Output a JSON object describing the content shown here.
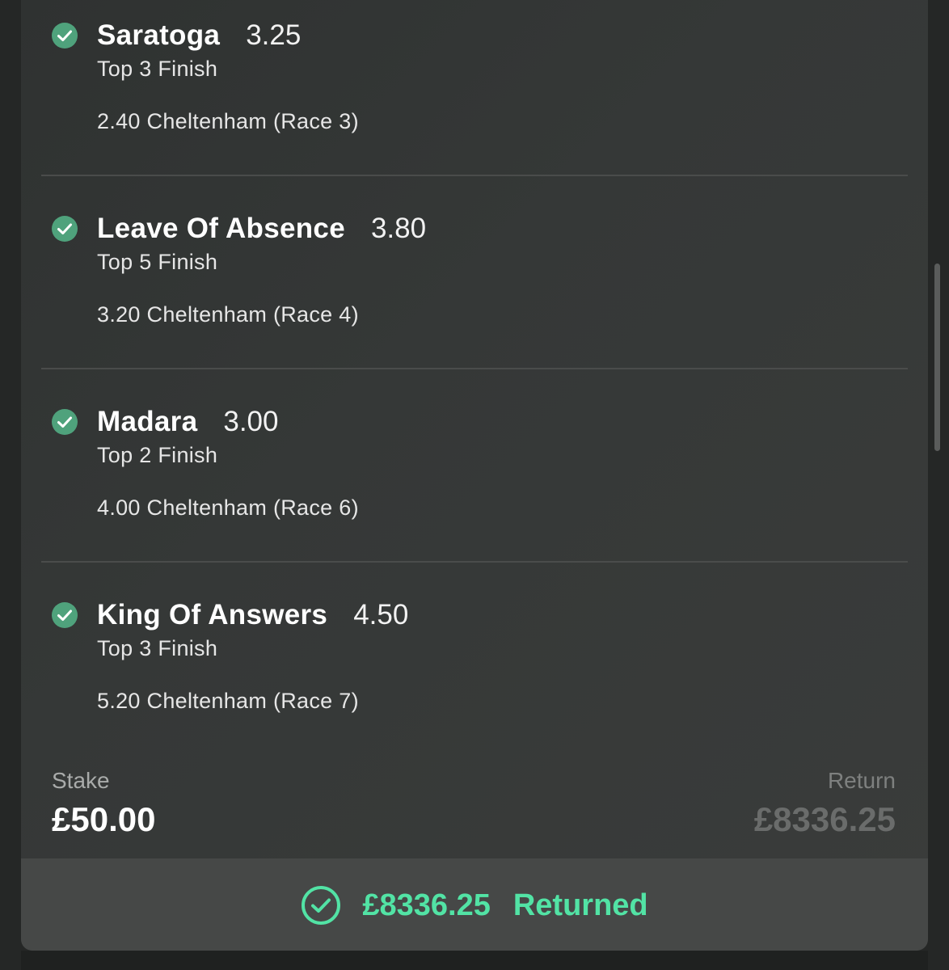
{
  "legs": [
    {
      "selection": "Saratoga",
      "odds": "3.25",
      "market": "Top 3 Finish",
      "event": "2.40 Cheltenham (Race 3)"
    },
    {
      "selection": "Leave Of Absence",
      "odds": "3.80",
      "market": "Top 5 Finish",
      "event": "3.20 Cheltenham (Race 4)"
    },
    {
      "selection": "Madara",
      "odds": "3.00",
      "market": "Top 2 Finish",
      "event": "4.00 Cheltenham (Race 6)"
    },
    {
      "selection": "King Of Answers",
      "odds": "4.50",
      "market": "Top 3 Finish",
      "event": "5.20 Cheltenham (Race 7)"
    }
  ],
  "summary": {
    "stake_label": "Stake",
    "stake_value": "£50.00",
    "return_label": "Return",
    "return_value": "£8336.25"
  },
  "returned": {
    "amount": "£8336.25",
    "label": "Returned"
  },
  "colors": {
    "check_green": "#4fa27c",
    "returned_green": "#52e3a5"
  },
  "icons": {
    "leg_status": "check-circle-filled-icon",
    "returned_status": "check-circle-outline-icon"
  }
}
